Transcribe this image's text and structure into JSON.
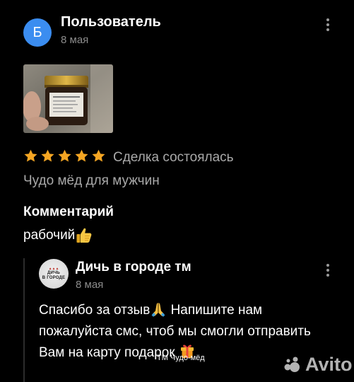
{
  "review": {
    "author_name": "Пользователь",
    "author_initial": "Б",
    "date": "8 мая",
    "rating": 5,
    "deal_status": "Сделка состоялась",
    "product_title": "Чудо мёд для мужчин",
    "photo_label": "Фото"
  },
  "comment": {
    "heading": "Комментарий",
    "text": "рабочий"
  },
  "reply": {
    "seller_name": "Дичь в городе тм",
    "seller_logo_text_line1": "ДИЧЬ",
    "seller_logo_text_line2": "В ГОРОДЕ",
    "date": "8 мая",
    "text_main": "Спасибо за отзыв",
    "text_rest": " Напишите нам пожалуйста смс, чтоб мы смогли отправить Вам на карту подарок "
  },
  "watermark": {
    "caption": "ТМ Чудо-мёд",
    "brand": "Avito"
  },
  "colors": {
    "background": "#000000",
    "avatar": "#3b8df0",
    "star": "#f5a623",
    "secondary_text": "#a9a9a9",
    "date_text": "#8c8c8c"
  }
}
